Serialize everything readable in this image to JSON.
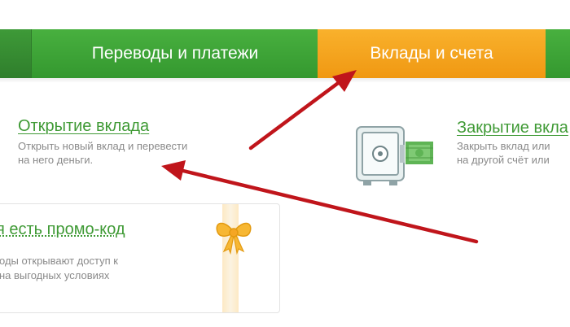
{
  "nav": {
    "tabs": [
      {
        "label": ""
      },
      {
        "label": "Переводы и платежи"
      },
      {
        "label": "Вклады и счета"
      },
      {
        "label": ""
      }
    ]
  },
  "open_deposit": {
    "title": "Открытие вклада",
    "desc_line1": "Открыть новый вклад и перевести",
    "desc_line2": "на него деньги."
  },
  "close_deposit": {
    "title": "Закрытие вкла",
    "desc_line1": "Закрыть вклад или",
    "desc_line2": "на другой счёт или"
  },
  "promo": {
    "title": "я есть промо-код",
    "desc_line1": "оды открывают доступ к",
    "desc_line2": "на выгодных условиях"
  },
  "colors": {
    "green": "#48b03f",
    "orange": "#f9a51f",
    "arrow": "#c0151b"
  },
  "icons": [
    "safe-icon",
    "bow-icon",
    "arrow-annotation"
  ]
}
